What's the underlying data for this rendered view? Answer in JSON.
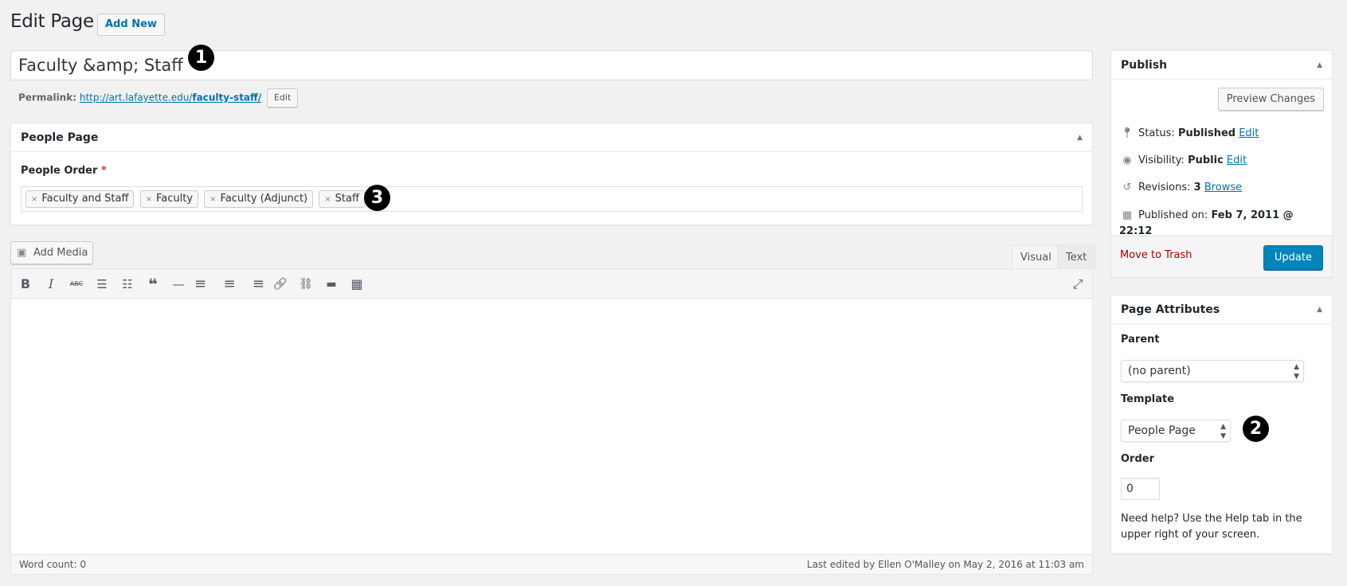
{
  "header": {
    "title": "Edit Page",
    "add_new_label": "Add New"
  },
  "post": {
    "title_value": "Faculty &amp; Staff",
    "permalink_label": "Permalink:",
    "permalink_base": "http://art.lafayette.edu/",
    "permalink_slug": "faculty-staff/",
    "permalink_edit_label": "Edit"
  },
  "people_box": {
    "title": "People Page",
    "field_label": "People Order",
    "required_mark": "*",
    "tags": [
      {
        "remove_icon": "×",
        "label": "Faculty and Staff"
      },
      {
        "remove_icon": "×",
        "label": "Faculty"
      },
      {
        "remove_icon": "×",
        "label": "Faculty (Adjunct)"
      },
      {
        "remove_icon": "×",
        "label": "Staff"
      }
    ]
  },
  "editor": {
    "add_media_label": "Add Media",
    "tabs": [
      {
        "label": "Visual",
        "active": true
      },
      {
        "label": "Text",
        "active": false
      }
    ],
    "toolbar": [
      {
        "name": "bold",
        "glyph": "B"
      },
      {
        "name": "italic",
        "glyph": "I"
      },
      {
        "name": "strikethrough",
        "glyph": "ABC"
      },
      {
        "name": "bulleted-list",
        "glyph": "☰"
      },
      {
        "name": "numbered-list",
        "glyph": "☷"
      },
      {
        "name": "blockquote",
        "glyph": "❝"
      },
      {
        "name": "horizontal-line",
        "glyph": "—"
      },
      {
        "name": "align-left",
        "glyph": "≡"
      },
      {
        "name": "align-center",
        "glyph": "≡"
      },
      {
        "name": "align-right",
        "glyph": "≡"
      },
      {
        "name": "insert-link",
        "glyph": "🔗"
      },
      {
        "name": "remove-link",
        "glyph": "⛓"
      },
      {
        "name": "read-more",
        "glyph": "▬"
      },
      {
        "name": "toolbar-toggle",
        "glyph": "▦"
      }
    ],
    "fullscreen_glyph": "⤢",
    "word_count": "Word count: 0",
    "last_edited": "Last edited by Ellen O'Malley on May 2, 2016 at 11:03 am"
  },
  "publish": {
    "title": "Publish",
    "preview_label": "Preview Changes",
    "status_label": "Status:",
    "status_value": "Published",
    "visibility_label": "Visibility:",
    "visibility_value": "Public",
    "revisions_label": "Revisions:",
    "revisions_value": "3",
    "browse_label": "Browse",
    "published_on_label": "Published on:",
    "published_on_value": "Feb 7, 2011 @ 22:12",
    "edit_label": "Edit",
    "trash_label": "Move to Trash",
    "update_label": "Update"
  },
  "attributes": {
    "title": "Page Attributes",
    "parent_label": "Parent",
    "parent_value": "(no parent)",
    "template_label": "Template",
    "template_value": "People Page",
    "order_label": "Order",
    "order_value": "0",
    "help_text": "Need help? Use the Help tab in the upper right of your screen."
  },
  "annotations": [
    "1",
    "2",
    "3"
  ],
  "colors": {
    "accent": "#0073aa",
    "primary_button": "#0085ba",
    "trash": "#aa0000",
    "background": "#f1f1f1"
  }
}
